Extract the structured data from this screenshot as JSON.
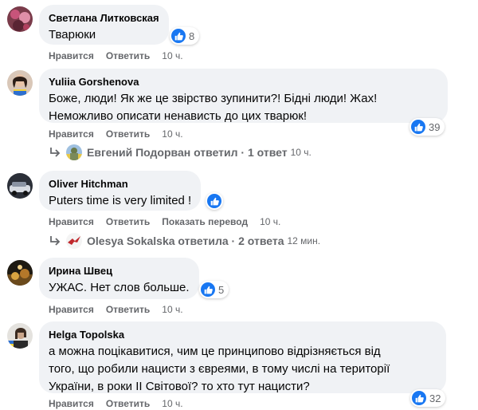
{
  "comments": [
    {
      "author": "Светлана Литковская",
      "text": "Тварюки",
      "likes": "8",
      "actions": {
        "like": "Нравится",
        "reply": "Ответить",
        "time": "10 ч."
      }
    },
    {
      "author": "Yuliia Gorshenova",
      "text": "Боже, люди! Як же це звірство зупинити?! Бідні люди! Жах!\nНеможливо описати ненависть до цих тварюк!",
      "likes": "39",
      "actions": {
        "like": "Нравится",
        "reply": "Ответить",
        "time": "10 ч."
      },
      "replies": {
        "label": "Евгений Подорван ответил · 1 ответ",
        "time": "10 ч."
      }
    },
    {
      "author": "Oliver Hitchman",
      "text": "Puters time is very limited !",
      "likes": "",
      "actions": {
        "like": "Нравится",
        "reply": "Ответить",
        "translate": "Показать перевод",
        "time": "10 ч."
      },
      "replies": {
        "label": "Olesya Sokalska ответила · 2 ответа",
        "time": "12 мин."
      }
    },
    {
      "author": "Ирина Швец",
      "text": "УЖАС. Нет слов больше.",
      "likes": "5",
      "actions": {
        "like": "Нравится",
        "reply": "Ответить",
        "time": "10 ч."
      }
    },
    {
      "author": "Helga Topolska",
      "text": "а можна поцікавитися, чим це принципово відрізняється від\nтого, що робили нацисти з євреями, в тому числі на території\nУкраїни, в роки ІІ Світової? то хто тут нацисти?",
      "likes": "32",
      "actions": {
        "like": "Нравится",
        "reply": "Ответить",
        "time": "10 ч."
      }
    }
  ],
  "colors": {
    "like_blue": "#1877f2",
    "bubble_bg": "#f0f2f5",
    "meta_gray": "#65676b"
  }
}
